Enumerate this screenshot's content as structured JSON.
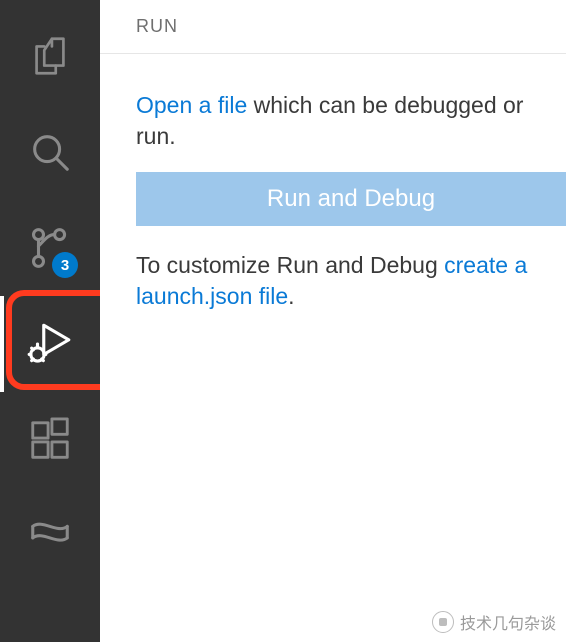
{
  "activity": {
    "explorer": "explorer",
    "search": "search",
    "scm": "source-control",
    "scm_badge": "3",
    "run": "run-and-debug",
    "extensions": "extensions",
    "other": "other"
  },
  "panel": {
    "header": "RUN",
    "line1_link": "Open a file",
    "line1_rest": " which can be debugged or run.",
    "button": "Run and Debug",
    "line2_lead": "To customize Run and Debug ",
    "line2_link": "create a launch.json file",
    "line2_tail": "."
  },
  "footer": {
    "text": "技术几句杂谈"
  }
}
